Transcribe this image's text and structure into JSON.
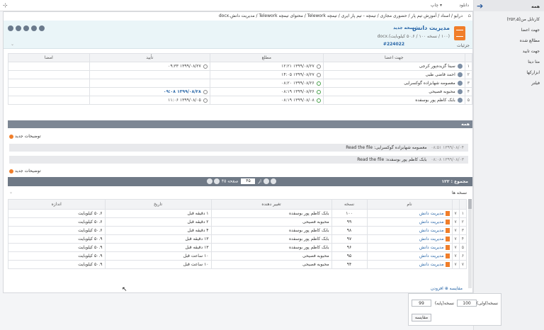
{
  "topbar": {
    "download": "دانلود",
    "print": "چاپ ▾"
  },
  "sidebar": {
    "items": [
      "همه",
      "کارتابل من(۲۵۲٫۵)",
      "جهت اعضا",
      "مطالع شده",
      "جهت تایید",
      "متا دیتا",
      "ابزارکها",
      "فیلتر"
    ]
  },
  "breadcrumb": "درایو / اسناد / آموزش تیم پار / حضوری مجازی / تیمچه - تیم پار ایری / تیمچه Telework / محتوای تیمچه Telework / مدیریت دانش.docx",
  "header": {
    "title": "مدیریت دانش",
    "new_version": "نسخه جدید",
    "subtitle": "(۱۰۰ / نسخه ۱۰۰ / ۵۰.۶ کیلوبایت).docx",
    "doc_number": "#224022",
    "details": "جزئیات"
  },
  "approvals": {
    "headers": [
      "جهت اعضا",
      "مطلع",
      "تأیید",
      "امضا"
    ],
    "rows": [
      {
        "n": "۱",
        "name": "سینا گزیده‌پور کرجی",
        "read": "۱۳۹۹/۰۸/۲۷ ۰۹:۳۳",
        "read_ok": false,
        "approve": "۱۳۹۹/۰۸/۲۷ ۱۲:۲۱",
        "approve_blue": false,
        "approve_ok": false
      },
      {
        "n": "۲",
        "name": "احمد قاضی طبی",
        "read": "",
        "read_ok": false,
        "approve": "۱۳۹۹/۰۸/۲۷ ۱۴:۰۵",
        "approve_blue": false,
        "approve_ok": false
      },
      {
        "n": "۳",
        "name": "معصومه شهابزاده گوکسرایی",
        "read": "",
        "read_ok": false,
        "approve": "۱۳۹۹/۰۸/۲۶ ۰۸:۲۰",
        "approve_blue": false,
        "approve_ok": true
      },
      {
        "n": "۴",
        "name": "محبوبه فصیحی",
        "read": "۱۳۹۹/۰۸/۲۸ ۰۹:۰۸",
        "read_blue": true,
        "approve": "۱۳۹۹/۰۸/۲۶ ۰۸:۱۹",
        "approve_ok": true
      },
      {
        "n": "۵",
        "name": "بابک کاظم پور بوسفده",
        "read": "۱۳۹۹/۰۸/۰۵ ۱۱:۰۶",
        "read_blue": false,
        "approve": "۱۳۹۹/۰۸/۰۸ ۰۸:۱۹",
        "approve_ok": true
      }
    ]
  },
  "filter": {
    "label": "همه"
  },
  "comments": {
    "new_label": "توضیحات جدید",
    "items": [
      {
        "date": "۱۳۹۹/۰۸/۰۴ ۰۸:۵۱",
        "text": "معصومه شهابزاده گوکسرایی: Read the file"
      },
      {
        "date": "۱۳۹۹/۰۸/۰۳ ۰۸:۰۸",
        "text": "بابک کاظم پور بوسفده: Read the file"
      }
    ]
  },
  "pager": {
    "total": "مجموع : ۱۲۲",
    "page_label": "صفحه",
    "page_value": "۴۵",
    "of": "از",
    "pages": "۴۵"
  },
  "versions": {
    "title": "نسخه ها",
    "headers": [
      "نام",
      "نسخه",
      "تغییر دهنده",
      "تاریخ",
      "اندازه"
    ],
    "rows": [
      {
        "n": "۱",
        "flag": "۷",
        "name": "مدیریت دانش",
        "ver": "۱۰۰",
        "by": "بابک کاظم پور بوسفده",
        "date": "۱ دقیقه قبل",
        "size": "۵۰.۶ کیلوبایت"
      },
      {
        "n": "۲",
        "flag": "۷",
        "name": "مدیریت دانش",
        "ver": "۹۹",
        "by": "محبوبه فصیحی",
        "date": "۲ دقیقه قبل",
        "size": "۵۰.۶ کیلوبایت"
      },
      {
        "n": "۳",
        "flag": "۷",
        "name": "مدیریت دانش",
        "ver": "۹۸",
        "by": "بابک کاظم پور بوسفده",
        "date": "۴ دقیقه قبل",
        "size": "۵۰.۶ کیلوبایت"
      },
      {
        "n": "۴",
        "flag": "۷",
        "name": "مدیریت دانش",
        "ver": "۹۷",
        "by": "بابک کاظم پور بوسفده",
        "date": "۱۳ دقیقه قبل",
        "size": "۵۰.۹ کیلوبایت"
      },
      {
        "n": "۵",
        "flag": "۷",
        "name": "مدیریت دانش",
        "ver": "۹۶",
        "by": "بابک کاظم پور بوسفده",
        "date": "۱۳ دقیقه قبل",
        "size": "۵۰.۹ کیلوبایت"
      },
      {
        "n": "۶",
        "flag": "۷",
        "name": "مدیریت دانش",
        "ver": "۹۵",
        "by": "محبوبه فصیحی",
        "date": "۱۰ ساعت قبل",
        "size": "۵۰.۹ کیلوبایت"
      },
      {
        "n": "۷",
        "flag": "۷",
        "name": "مدیریت دانش",
        "ver": "۹۴",
        "by": "محبوبه فصیحی",
        "date": "۱۰ ساعت قبل",
        "size": "۵۰.۹ کیلوبایت"
      }
    ]
  },
  "compare": {
    "bar_text": "مقایسه ⊕ افزودن",
    "version1_label": "نسخه(اولی)",
    "version1_value": "100",
    "version2_label": "نسخه(پایه)",
    "version2_value": "99",
    "button": "مقایسه"
  }
}
